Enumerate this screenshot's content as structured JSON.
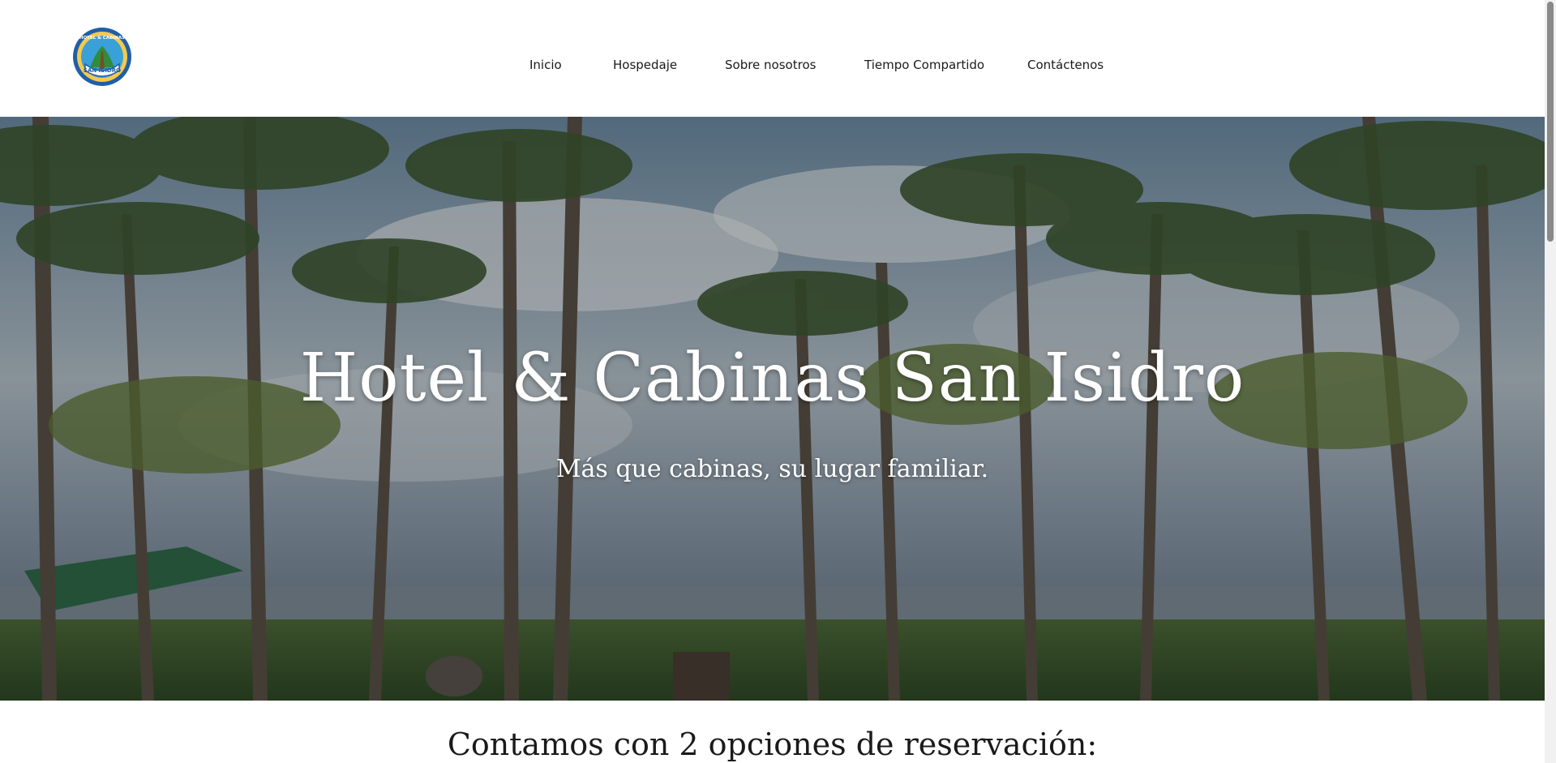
{
  "header": {
    "logo_text": "HOTEL & CABINAS SAN ISIDRO",
    "nav": [
      {
        "label": "Inicio"
      },
      {
        "label": "Hospedaje"
      },
      {
        "label": "Sobre nosotros"
      },
      {
        "label": "Tiempo Compartido"
      },
      {
        "label": "Contáctenos"
      }
    ]
  },
  "hero": {
    "title": "Hotel & Cabinas San Isidro",
    "subtitle": "Más que cabinas, su lugar familiar."
  },
  "main": {
    "section_heading": "Contamos con 2 opciones de reservación:"
  },
  "colors": {
    "header_bg": "#ffffff",
    "text_dark": "#1a1a1a",
    "hero_text": "#ffffff"
  }
}
